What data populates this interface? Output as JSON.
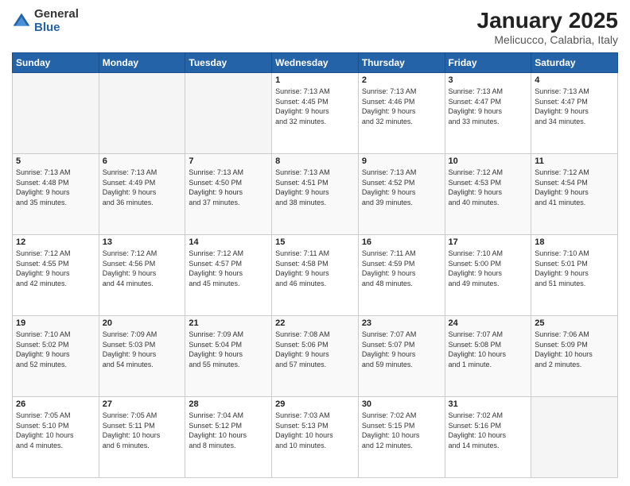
{
  "logo": {
    "line1": "General",
    "line2": "Blue"
  },
  "header": {
    "title": "January 2025",
    "subtitle": "Melicucco, Calabria, Italy"
  },
  "days_of_week": [
    "Sunday",
    "Monday",
    "Tuesday",
    "Wednesday",
    "Thursday",
    "Friday",
    "Saturday"
  ],
  "weeks": [
    [
      {
        "day": "",
        "info": ""
      },
      {
        "day": "",
        "info": ""
      },
      {
        "day": "",
        "info": ""
      },
      {
        "day": "1",
        "info": "Sunrise: 7:13 AM\nSunset: 4:45 PM\nDaylight: 9 hours\nand 32 minutes."
      },
      {
        "day": "2",
        "info": "Sunrise: 7:13 AM\nSunset: 4:46 PM\nDaylight: 9 hours\nand 32 minutes."
      },
      {
        "day": "3",
        "info": "Sunrise: 7:13 AM\nSunset: 4:47 PM\nDaylight: 9 hours\nand 33 minutes."
      },
      {
        "day": "4",
        "info": "Sunrise: 7:13 AM\nSunset: 4:47 PM\nDaylight: 9 hours\nand 34 minutes."
      }
    ],
    [
      {
        "day": "5",
        "info": "Sunrise: 7:13 AM\nSunset: 4:48 PM\nDaylight: 9 hours\nand 35 minutes."
      },
      {
        "day": "6",
        "info": "Sunrise: 7:13 AM\nSunset: 4:49 PM\nDaylight: 9 hours\nand 36 minutes."
      },
      {
        "day": "7",
        "info": "Sunrise: 7:13 AM\nSunset: 4:50 PM\nDaylight: 9 hours\nand 37 minutes."
      },
      {
        "day": "8",
        "info": "Sunrise: 7:13 AM\nSunset: 4:51 PM\nDaylight: 9 hours\nand 38 minutes."
      },
      {
        "day": "9",
        "info": "Sunrise: 7:13 AM\nSunset: 4:52 PM\nDaylight: 9 hours\nand 39 minutes."
      },
      {
        "day": "10",
        "info": "Sunrise: 7:12 AM\nSunset: 4:53 PM\nDaylight: 9 hours\nand 40 minutes."
      },
      {
        "day": "11",
        "info": "Sunrise: 7:12 AM\nSunset: 4:54 PM\nDaylight: 9 hours\nand 41 minutes."
      }
    ],
    [
      {
        "day": "12",
        "info": "Sunrise: 7:12 AM\nSunset: 4:55 PM\nDaylight: 9 hours\nand 42 minutes."
      },
      {
        "day": "13",
        "info": "Sunrise: 7:12 AM\nSunset: 4:56 PM\nDaylight: 9 hours\nand 44 minutes."
      },
      {
        "day": "14",
        "info": "Sunrise: 7:12 AM\nSunset: 4:57 PM\nDaylight: 9 hours\nand 45 minutes."
      },
      {
        "day": "15",
        "info": "Sunrise: 7:11 AM\nSunset: 4:58 PM\nDaylight: 9 hours\nand 46 minutes."
      },
      {
        "day": "16",
        "info": "Sunrise: 7:11 AM\nSunset: 4:59 PM\nDaylight: 9 hours\nand 48 minutes."
      },
      {
        "day": "17",
        "info": "Sunrise: 7:10 AM\nSunset: 5:00 PM\nDaylight: 9 hours\nand 49 minutes."
      },
      {
        "day": "18",
        "info": "Sunrise: 7:10 AM\nSunset: 5:01 PM\nDaylight: 9 hours\nand 51 minutes."
      }
    ],
    [
      {
        "day": "19",
        "info": "Sunrise: 7:10 AM\nSunset: 5:02 PM\nDaylight: 9 hours\nand 52 minutes."
      },
      {
        "day": "20",
        "info": "Sunrise: 7:09 AM\nSunset: 5:03 PM\nDaylight: 9 hours\nand 54 minutes."
      },
      {
        "day": "21",
        "info": "Sunrise: 7:09 AM\nSunset: 5:04 PM\nDaylight: 9 hours\nand 55 minutes."
      },
      {
        "day": "22",
        "info": "Sunrise: 7:08 AM\nSunset: 5:06 PM\nDaylight: 9 hours\nand 57 minutes."
      },
      {
        "day": "23",
        "info": "Sunrise: 7:07 AM\nSunset: 5:07 PM\nDaylight: 9 hours\nand 59 minutes."
      },
      {
        "day": "24",
        "info": "Sunrise: 7:07 AM\nSunset: 5:08 PM\nDaylight: 10 hours\nand 1 minute."
      },
      {
        "day": "25",
        "info": "Sunrise: 7:06 AM\nSunset: 5:09 PM\nDaylight: 10 hours\nand 2 minutes."
      }
    ],
    [
      {
        "day": "26",
        "info": "Sunrise: 7:05 AM\nSunset: 5:10 PM\nDaylight: 10 hours\nand 4 minutes."
      },
      {
        "day": "27",
        "info": "Sunrise: 7:05 AM\nSunset: 5:11 PM\nDaylight: 10 hours\nand 6 minutes."
      },
      {
        "day": "28",
        "info": "Sunrise: 7:04 AM\nSunset: 5:12 PM\nDaylight: 10 hours\nand 8 minutes."
      },
      {
        "day": "29",
        "info": "Sunrise: 7:03 AM\nSunset: 5:13 PM\nDaylight: 10 hours\nand 10 minutes."
      },
      {
        "day": "30",
        "info": "Sunrise: 7:02 AM\nSunset: 5:15 PM\nDaylight: 10 hours\nand 12 minutes."
      },
      {
        "day": "31",
        "info": "Sunrise: 7:02 AM\nSunset: 5:16 PM\nDaylight: 10 hours\nand 14 minutes."
      },
      {
        "day": "",
        "info": ""
      }
    ]
  ]
}
